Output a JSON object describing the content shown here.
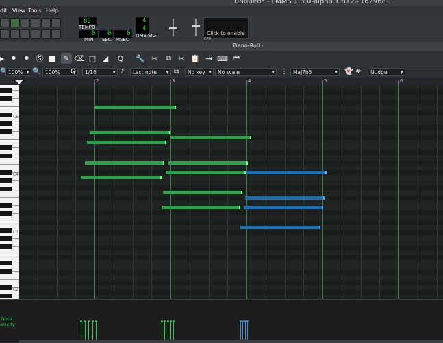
{
  "window_title": "Untitled* - LMMS 1.3.0-alpha.1.812+16296c1",
  "menu": [
    "dit",
    "View",
    "Tools",
    "Help"
  ],
  "transport": {
    "tempo_label": "TEMPO",
    "tempo_value": "82",
    "min_label": "MIN",
    "min_value": "0",
    "sec_label": "SEC",
    "sec_value": "0",
    "msec_label": "MSEC",
    "msec_value": "0",
    "timesig_label": "TIME SIG",
    "timesig_num": "4",
    "timesig_den": "4",
    "cpu_text": "Click to enable",
    "cpu_label": "CPU"
  },
  "piano_roll_title": "Piano-Roll -",
  "options": {
    "zoom_x": "100%",
    "zoom_y": "100%",
    "quantize": "1/16",
    "note_length": "Last note",
    "key": "No key",
    "scale": "No scale",
    "chord": "Maj7b5",
    "snap": "Nudge"
  },
  "ruler_bars": [
    "2",
    "3",
    "4",
    "5",
    "6"
  ],
  "key_labels": [
    "C5",
    "C4",
    "C3",
    "C2"
  ],
  "velocity_labels": [
    "Note",
    "elocity:"
  ],
  "colors": {
    "note_green": "#2ea04d",
    "note_blue": "#1f6eae",
    "grid_bg": "#1f2321",
    "accent_green": "#3cc25a"
  },
  "notes_green": [
    {
      "row": 4,
      "start": 2.0,
      "end": 3.07
    },
    {
      "row": 9,
      "start": 1.94,
      "end": 3.0
    },
    {
      "row": 10,
      "start": 3.0,
      "end": 4.06
    },
    {
      "row": 11,
      "start": 1.9,
      "end": 2.95
    },
    {
      "row": 15,
      "start": 1.87,
      "end": 2.92
    },
    {
      "row": 15,
      "start": 2.97,
      "end": 4.02
    },
    {
      "row": 17,
      "start": 2.94,
      "end": 3.99
    },
    {
      "row": 18,
      "start": 1.82,
      "end": 2.88
    },
    {
      "row": 21,
      "start": 2.9,
      "end": 3.95
    },
    {
      "row": 24,
      "start": 2.88,
      "end": 3.92
    }
  ],
  "notes_blue": [
    {
      "row": 17,
      "start": 4.0,
      "end": 5.05
    },
    {
      "row": 22,
      "start": 3.98,
      "end": 5.03
    },
    {
      "row": 24,
      "start": 3.96,
      "end": 5.01
    },
    {
      "row": 28,
      "start": 3.92,
      "end": 4.97
    }
  ],
  "velocity_groups": [
    {
      "color": "#3cc25a",
      "start": 1.82,
      "count": 5,
      "spacing": 0.05
    },
    {
      "color": "#3cc25a",
      "start": 2.88,
      "count": 5,
      "spacing": 0.04
    },
    {
      "color": "#3f8ad0",
      "start": 3.92,
      "count": 4,
      "spacing": 0.03
    }
  ]
}
